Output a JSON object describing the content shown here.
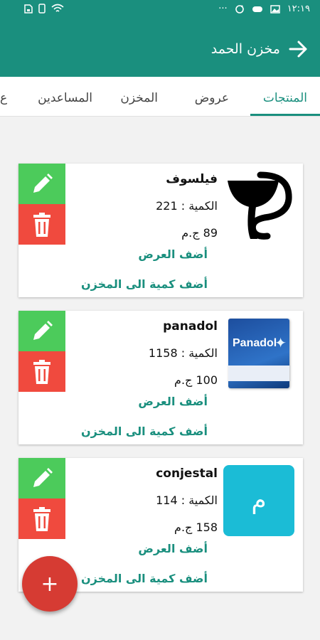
{
  "status_bar": {
    "time": "١٢:١٩",
    "dots": "···"
  },
  "app_bar": {
    "title": "مخزن الحمد"
  },
  "tabs": [
    {
      "label": "المنتجات",
      "active": true
    },
    {
      "label": "عروض",
      "active": false
    },
    {
      "label": "المخزن",
      "active": false
    },
    {
      "label": "المساعدين",
      "active": false
    },
    {
      "label": "ع",
      "active": false
    }
  ],
  "products": [
    {
      "name": "فيلسوف",
      "quantity": "الكمية : 221",
      "price": "89 ج.م",
      "add_offer": "أضف العرض",
      "add_stock": "أضف كمية الى المخزن",
      "image": "pharmacy-logo"
    },
    {
      "name": "panadol",
      "quantity": "الكمية : 1158",
      "price": "100 ج.م",
      "add_offer": "أضف العرض",
      "add_stock": "أضف كمية الى المخزن",
      "image": "panadol-box",
      "image_text": "Panadol"
    },
    {
      "name": "conjestal",
      "quantity": "الكمية : 114",
      "price": "158 ج.م",
      "add_offer": "أضف العرض",
      "add_stock": "أضف كمية الى المخزن",
      "image": "letter-avatar",
      "image_text": "م"
    }
  ],
  "fab": {
    "label": "+"
  },
  "colors": {
    "primary": "#1a8f7e",
    "edit": "#4ccb5b",
    "delete": "#f04a3e",
    "fab": "#d63b33",
    "avatar": "#1bbcd6"
  }
}
